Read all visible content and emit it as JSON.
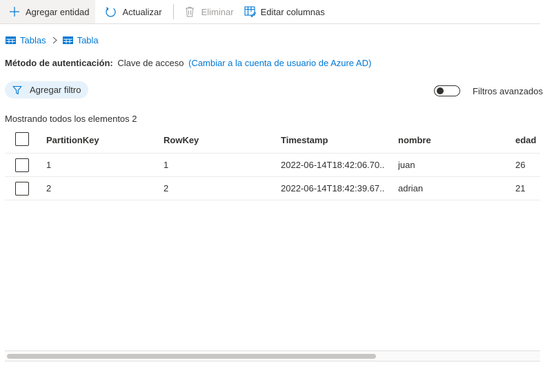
{
  "toolbar": {
    "add_entity": "Agregar entidad",
    "refresh": "Actualizar",
    "delete": "Eliminar",
    "edit_columns": "Editar columnas"
  },
  "breadcrumb": {
    "items": [
      "Tablas",
      "Tabla"
    ]
  },
  "auth": {
    "label": "Método de autenticación:",
    "value": "Clave de acceso",
    "switch_link": "(Cambiar a la cuenta de usuario de Azure AD)"
  },
  "filters": {
    "add_filter": "Agregar filtro",
    "advanced_label": "Filtros avanzados",
    "advanced_enabled": false
  },
  "grid": {
    "summary": "Mostrando todos los elementos 2",
    "columns": [
      "PartitionKey",
      "RowKey",
      "Timestamp",
      "nombre",
      "edad"
    ],
    "rows": [
      [
        "1",
        "1",
        "2022-06-14T18:42:06.70...",
        "juan",
        "26"
      ],
      [
        "2",
        "2",
        "2022-06-14T18:42:39.67...",
        "adrian",
        "21"
      ]
    ]
  },
  "icons": {
    "add": "plus-icon",
    "refresh": "refresh-icon",
    "delete": "trash-icon",
    "edit_columns": "edit-columns-icon",
    "table": "table-icon",
    "filter": "filter-icon"
  },
  "colors": {
    "accent": "#0078d4",
    "disabled": "#a19f9d",
    "filter_bg": "#e6f2fb"
  }
}
